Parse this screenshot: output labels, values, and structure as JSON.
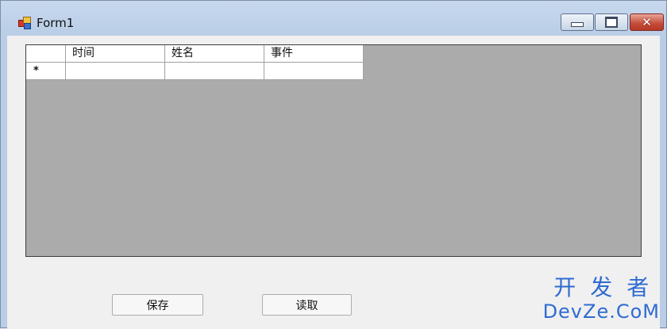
{
  "window": {
    "title": "Form1",
    "app_icon": "winforms-form-icon",
    "controls": {
      "minimize_icon": "minimize-icon",
      "maximize_icon": "maximize-icon",
      "close_icon": "close-icon",
      "close_glyph": "✕"
    }
  },
  "grid": {
    "columns": [
      "时间",
      "姓名",
      "事件"
    ],
    "new_row": {
      "indicator": "*",
      "cells": [
        "",
        "",
        ""
      ]
    },
    "background_color": "#ababab"
  },
  "buttons": {
    "save_label": "保存",
    "read_label": "读取"
  },
  "watermark": {
    "line1": "开发者",
    "line2": "DevZe.CoM"
  }
}
